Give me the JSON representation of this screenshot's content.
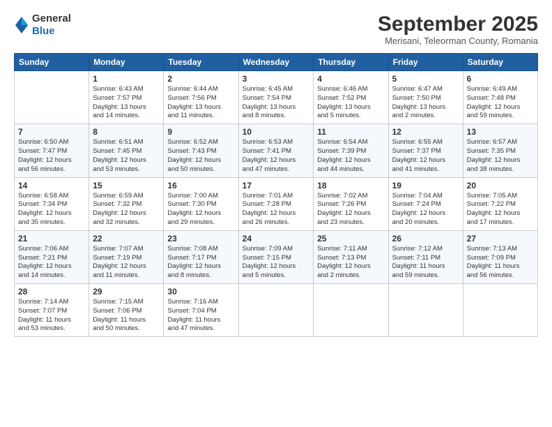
{
  "logo": {
    "general": "General",
    "blue": "Blue"
  },
  "title": "September 2025",
  "subtitle": "Merisani, Teleorman County, Romania",
  "headers": [
    "Sunday",
    "Monday",
    "Tuesday",
    "Wednesday",
    "Thursday",
    "Friday",
    "Saturday"
  ],
  "weeks": [
    [
      {
        "day": "",
        "text": ""
      },
      {
        "day": "1",
        "text": "Sunrise: 6:43 AM\nSunset: 7:57 PM\nDaylight: 13 hours\nand 14 minutes."
      },
      {
        "day": "2",
        "text": "Sunrise: 6:44 AM\nSunset: 7:56 PM\nDaylight: 13 hours\nand 11 minutes."
      },
      {
        "day": "3",
        "text": "Sunrise: 6:45 AM\nSunset: 7:54 PM\nDaylight: 13 hours\nand 8 minutes."
      },
      {
        "day": "4",
        "text": "Sunrise: 6:46 AM\nSunset: 7:52 PM\nDaylight: 13 hours\nand 5 minutes."
      },
      {
        "day": "5",
        "text": "Sunrise: 6:47 AM\nSunset: 7:50 PM\nDaylight: 13 hours\nand 2 minutes."
      },
      {
        "day": "6",
        "text": "Sunrise: 6:49 AM\nSunset: 7:48 PM\nDaylight: 12 hours\nand 59 minutes."
      }
    ],
    [
      {
        "day": "7",
        "text": "Sunrise: 6:50 AM\nSunset: 7:47 PM\nDaylight: 12 hours\nand 56 minutes."
      },
      {
        "day": "8",
        "text": "Sunrise: 6:51 AM\nSunset: 7:45 PM\nDaylight: 12 hours\nand 53 minutes."
      },
      {
        "day": "9",
        "text": "Sunrise: 6:52 AM\nSunset: 7:43 PM\nDaylight: 12 hours\nand 50 minutes."
      },
      {
        "day": "10",
        "text": "Sunrise: 6:53 AM\nSunset: 7:41 PM\nDaylight: 12 hours\nand 47 minutes."
      },
      {
        "day": "11",
        "text": "Sunrise: 6:54 AM\nSunset: 7:39 PM\nDaylight: 12 hours\nand 44 minutes."
      },
      {
        "day": "12",
        "text": "Sunrise: 6:55 AM\nSunset: 7:37 PM\nDaylight: 12 hours\nand 41 minutes."
      },
      {
        "day": "13",
        "text": "Sunrise: 6:57 AM\nSunset: 7:35 PM\nDaylight: 12 hours\nand 38 minutes."
      }
    ],
    [
      {
        "day": "14",
        "text": "Sunrise: 6:58 AM\nSunset: 7:34 PM\nDaylight: 12 hours\nand 35 minutes."
      },
      {
        "day": "15",
        "text": "Sunrise: 6:59 AM\nSunset: 7:32 PM\nDaylight: 12 hours\nand 32 minutes."
      },
      {
        "day": "16",
        "text": "Sunrise: 7:00 AM\nSunset: 7:30 PM\nDaylight: 12 hours\nand 29 minutes."
      },
      {
        "day": "17",
        "text": "Sunrise: 7:01 AM\nSunset: 7:28 PM\nDaylight: 12 hours\nand 26 minutes."
      },
      {
        "day": "18",
        "text": "Sunrise: 7:02 AM\nSunset: 7:26 PM\nDaylight: 12 hours\nand 23 minutes."
      },
      {
        "day": "19",
        "text": "Sunrise: 7:04 AM\nSunset: 7:24 PM\nDaylight: 12 hours\nand 20 minutes."
      },
      {
        "day": "20",
        "text": "Sunrise: 7:05 AM\nSunset: 7:22 PM\nDaylight: 12 hours\nand 17 minutes."
      }
    ],
    [
      {
        "day": "21",
        "text": "Sunrise: 7:06 AM\nSunset: 7:21 PM\nDaylight: 12 hours\nand 14 minutes."
      },
      {
        "day": "22",
        "text": "Sunrise: 7:07 AM\nSunset: 7:19 PM\nDaylight: 12 hours\nand 11 minutes."
      },
      {
        "day": "23",
        "text": "Sunrise: 7:08 AM\nSunset: 7:17 PM\nDaylight: 12 hours\nand 8 minutes."
      },
      {
        "day": "24",
        "text": "Sunrise: 7:09 AM\nSunset: 7:15 PM\nDaylight: 12 hours\nand 5 minutes."
      },
      {
        "day": "25",
        "text": "Sunrise: 7:11 AM\nSunset: 7:13 PM\nDaylight: 12 hours\nand 2 minutes."
      },
      {
        "day": "26",
        "text": "Sunrise: 7:12 AM\nSunset: 7:11 PM\nDaylight: 11 hours\nand 59 minutes."
      },
      {
        "day": "27",
        "text": "Sunrise: 7:13 AM\nSunset: 7:09 PM\nDaylight: 11 hours\nand 56 minutes."
      }
    ],
    [
      {
        "day": "28",
        "text": "Sunrise: 7:14 AM\nSunset: 7:07 PM\nDaylight: 11 hours\nand 53 minutes."
      },
      {
        "day": "29",
        "text": "Sunrise: 7:15 AM\nSunset: 7:06 PM\nDaylight: 11 hours\nand 50 minutes."
      },
      {
        "day": "30",
        "text": "Sunrise: 7:16 AM\nSunset: 7:04 PM\nDaylight: 11 hours\nand 47 minutes."
      },
      {
        "day": "",
        "text": ""
      },
      {
        "day": "",
        "text": ""
      },
      {
        "day": "",
        "text": ""
      },
      {
        "day": "",
        "text": ""
      }
    ]
  ]
}
